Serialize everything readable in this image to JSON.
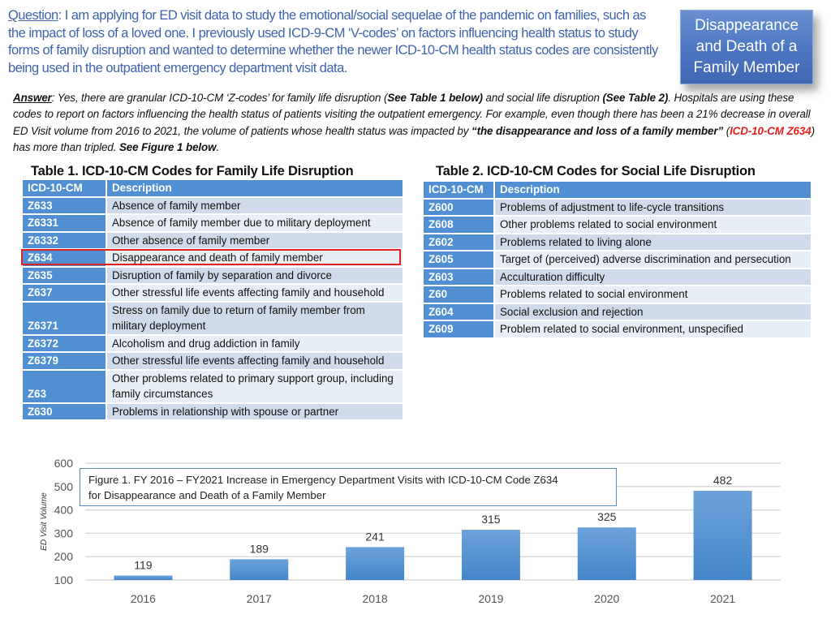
{
  "question": {
    "label": "Question",
    "text": ": I am applying for ED visit data to study the emotional/social sequelae of the pandemic on families, such as the impact of loss of a loved one. I previously used ICD-9-CM ‘V-codes’ on factors influencing health status  to study forms of family disruption and wanted to determine whether the newer ICD-10-CM health status codes are consistently being used in the outpatient emergency department visit data."
  },
  "callout": {
    "text": "Disappearance and Death of a Family Member"
  },
  "answer": {
    "label": "Answer",
    "part1": ": Yes, there are granular ICD-10-CM ‘Z-codes’ for family life disruption (",
    "ref_table1": "See Table 1 below)",
    "part2": " and social life disruption ",
    "ref_table2": "(See Table 2)",
    "part3": ".  Hospitals are using these codes to report on factors influencing the health status of patients visiting the outpatient emergency.  For example, even though there has been a 21% decrease in overall ED Visit volume from 2016 to 2021, the volume of patients whose health status was impacted by ",
    "quote": "“the disappearance and loss of a family member”",
    "part4": " (",
    "code_ref": "ICD-10-CM Z634",
    "part5": ") has more than tripled. ",
    "ref_figure": "See Figure 1 below",
    "part6": "."
  },
  "table1": {
    "title": "Table 1. ICD-10-CM Codes for Family Life Disruption",
    "headers": [
      "ICD-10-CM",
      "Description"
    ],
    "highlighted_code": "Z634",
    "rows": [
      {
        "code": "Z633",
        "desc": "Absence of family member"
      },
      {
        "code": "Z6331",
        "desc": "Absence of family member due to military deployment"
      },
      {
        "code": "Z6332",
        "desc": "Other absence of family member"
      },
      {
        "code": "Z634",
        "desc": "Disappearance and death of family member"
      },
      {
        "code": "Z635",
        "desc": "Disruption of family by separation and divorce"
      },
      {
        "code": "Z637",
        "desc": "Other stressful life events affecting family and household"
      },
      {
        "code": "Z6371",
        "desc": "Stress on family due to return of family member from military deployment"
      },
      {
        "code": "Z6372",
        "desc": "Alcoholism and drug addiction in family"
      },
      {
        "code": "Z6379",
        "desc": "Other stressful life events affecting family and household"
      },
      {
        "code": "Z63",
        "desc": "Other problems related to primary support group, including family circumstances"
      },
      {
        "code": "Z630",
        "desc": "Problems in relationship with spouse or partner"
      }
    ]
  },
  "table2": {
    "title": "Table 2. ICD-10-CM Codes for Social Life Disruption",
    "headers": [
      "ICD-10-CM",
      "Description"
    ],
    "rows": [
      {
        "code": "Z600",
        "desc": "Problems of adjustment to life-cycle transitions"
      },
      {
        "code": "Z608",
        "desc": "Other problems related to social environment"
      },
      {
        "code": "Z602",
        "desc": "Problems related to living alone"
      },
      {
        "code": "Z605",
        "desc": "Target of (perceived) adverse discrimination and persecution"
      },
      {
        "code": "Z603",
        "desc": "Acculturation difficulty"
      },
      {
        "code": "Z60",
        "desc": "Problems related to social environment"
      },
      {
        "code": "Z604",
        "desc": "Social exclusion and rejection"
      },
      {
        "code": "Z609",
        "desc": "Problem related to social environment, unspecified"
      }
    ]
  },
  "colors": {
    "header_blue": "#4f8fd2",
    "row_dark": "#cfdbea",
    "row_light": "#e8eef6",
    "highlight_red": "#e02020",
    "question_blue": "#3f64ad",
    "bar_blue": "#5b9bd5"
  },
  "chart_data": {
    "type": "bar",
    "title": "Figure 1. FY 2016 – FY2021 Increase in Emergency Department Visits with  ICD-10-CM Code Z634 for Disappearance and Death of a Family Member",
    "title_line1": "Figure 1. FY 2016 – FY2021 Increase in Emergency Department Visits with  ICD-10-CM Code Z634",
    "title_line2": "for Disappearance and Death of a Family Member",
    "categories": [
      "2016",
      "2017",
      "2018",
      "2019",
      "2020",
      "2021"
    ],
    "values": [
      119,
      189,
      241,
      315,
      325,
      482
    ],
    "data_labels": [
      "119",
      "189",
      "241",
      "315",
      "325",
      "482"
    ],
    "xlabel": "",
    "ylabel": "ED Visit Volume",
    "ylim": [
      100,
      600
    ],
    "yticks": [
      100,
      200,
      300,
      400,
      500,
      600
    ],
    "grid": true,
    "legend": "none"
  }
}
